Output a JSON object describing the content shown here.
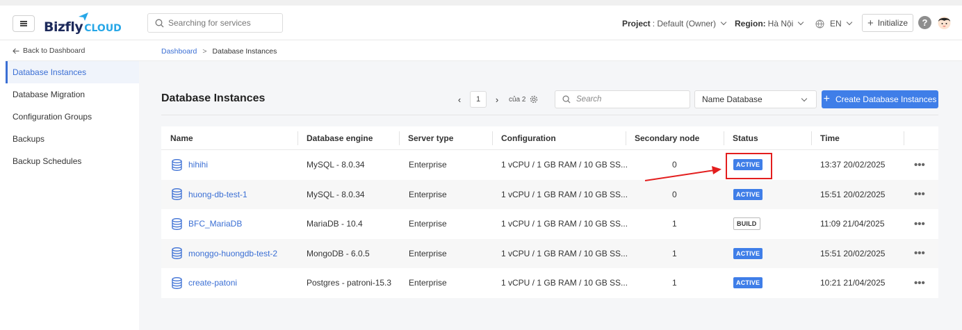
{
  "header": {
    "logo_main": "Bizfly",
    "logo_sub": "CLOUD",
    "search_placeholder": "Searching for services",
    "project_label": "Project",
    "project_value": ": Default (Owner)",
    "region_label": "Region:",
    "region_value": "Hà Nội",
    "language": "EN",
    "initialize_label": "Initialize",
    "help_label": "?"
  },
  "sidebar": {
    "back_label": "Back to Dashboard",
    "items": [
      {
        "label": "Database Instances",
        "active": true
      },
      {
        "label": "Database Migration",
        "active": false
      },
      {
        "label": "Configuration Groups",
        "active": false
      },
      {
        "label": "Backups",
        "active": false
      },
      {
        "label": "Backup Schedules",
        "active": false
      }
    ]
  },
  "breadcrumb": {
    "root": "Dashboard",
    "separator": ">",
    "current": "Database Instances"
  },
  "main": {
    "title": "Database Instances",
    "pager": {
      "prev": "‹",
      "page": "1",
      "next": "›",
      "of_text": "của 2"
    },
    "search_placeholder": "Search",
    "select_value": "Name Database",
    "create_label": "Create Database Instances"
  },
  "table": {
    "columns": [
      "Name",
      "Database engine",
      "Server type",
      "Configuration",
      "Secondary node",
      "Status",
      "Time"
    ],
    "rows": [
      {
        "name": "hihihi",
        "engine": "MySQL - 8.0.34",
        "server": "Enterprise",
        "config": "1 vCPU / 1 GB RAM / 10 GB SS...",
        "secondary": "0",
        "status": "ACTIVE",
        "time": "13:37 20/02/2025"
      },
      {
        "name": "huong-db-test-1",
        "engine": "MySQL - 8.0.34",
        "server": "Enterprise",
        "config": "1 vCPU / 1 GB RAM / 10 GB SS...",
        "secondary": "0",
        "status": "ACTIVE",
        "time": "15:51 20/02/2025"
      },
      {
        "name": "BFC_MariaDB",
        "engine": "MariaDB - 10.4",
        "server": "Enterprise",
        "config": "1 vCPU / 1 GB RAM / 10 GB SS...",
        "secondary": "1",
        "status": "BUILD",
        "time": "11:09 21/04/2025"
      },
      {
        "name": "monggo-huongdb-test-2",
        "engine": "MongoDB - 6.0.5",
        "server": "Enterprise",
        "config": "1 vCPU / 1 GB RAM / 10 GB SS...",
        "secondary": "1",
        "status": "ACTIVE",
        "time": "15:51 20/02/2025"
      },
      {
        "name": "create-patoni",
        "engine": "Postgres - patroni-15.3",
        "server": "Enterprise",
        "config": "1 vCPU / 1 GB RAM / 10 GB SS...",
        "secondary": "1",
        "status": "ACTIVE",
        "time": "10:21 21/04/2025"
      }
    ],
    "more_label": "•••"
  },
  "colors": {
    "accent": "#3f7ee8",
    "link": "#3b6fd4",
    "annotation": "#e31e1e"
  }
}
